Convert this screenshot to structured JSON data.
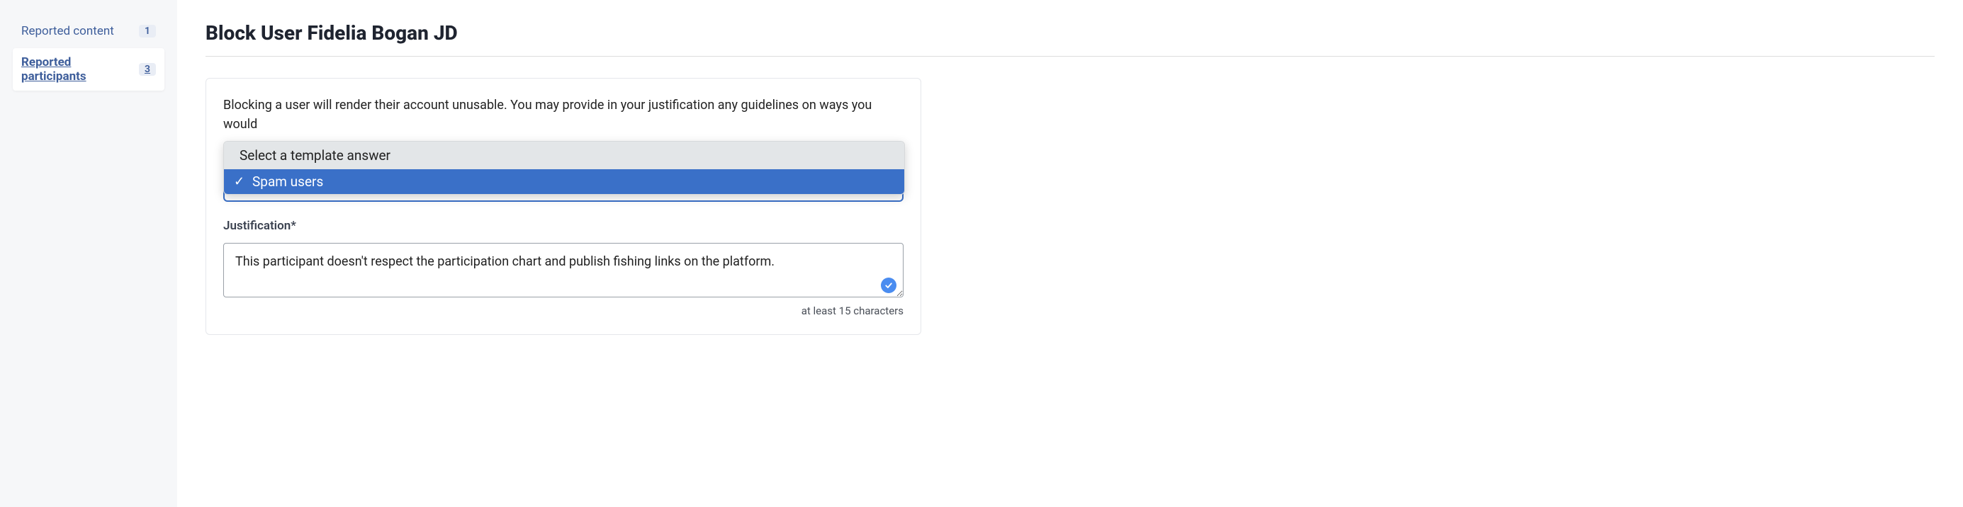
{
  "sidebar": {
    "items": [
      {
        "label": "Reported content",
        "count": "1"
      },
      {
        "label": "Reported participants",
        "count": "3"
      }
    ]
  },
  "page": {
    "title": "Block User Fidelia Bogan JD"
  },
  "form": {
    "intro": "Blocking a user will render their account unusable. You may provide in your justification any guidelines on ways you would",
    "template_select": {
      "placeholder": "Select a template answer",
      "options": [
        "Spam users"
      ],
      "selected": "Spam users"
    },
    "justification": {
      "label": "Justification*",
      "value": "This participant doesn't respect the participation chart and publish fishing links on the platform.",
      "hint": "at least 15 characters"
    }
  }
}
